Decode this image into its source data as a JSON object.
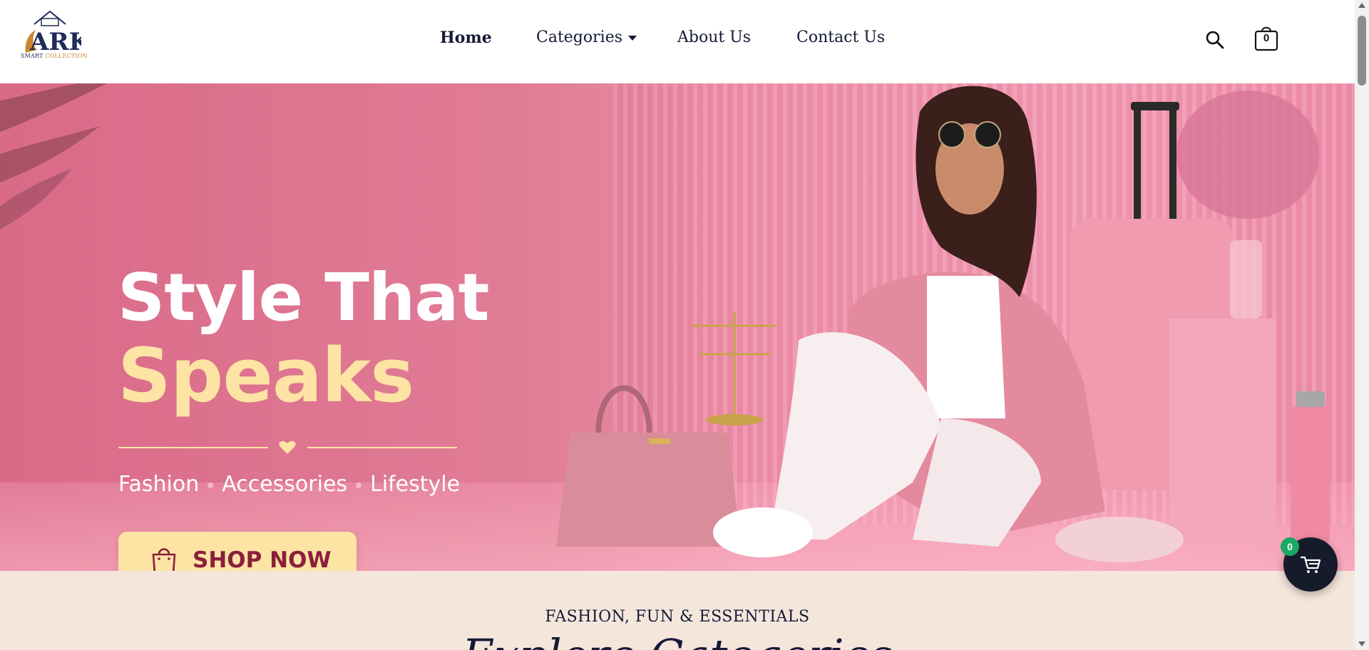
{
  "brand": {
    "logo_letters": "ARK",
    "logo_tagline_1": "SMART",
    "logo_tagline_2": "COLLECTION"
  },
  "nav": {
    "items": [
      {
        "label": "Home",
        "active": true
      },
      {
        "label": "Categories",
        "has_dropdown": true
      },
      {
        "label": "About Us"
      },
      {
        "label": "Contact Us"
      }
    ]
  },
  "header_actions": {
    "search_icon": "search-icon",
    "bag_icon": "shopping-bag-icon",
    "bag_count": "0"
  },
  "hero": {
    "headline_line1": "Style That",
    "headline_line2": "Speaks",
    "tagline_items": [
      "Fashion",
      "Accessories",
      "Lifestyle"
    ],
    "cta_label": "SHOP NOW",
    "colors": {
      "headline_white": "#ffffff",
      "headline_accent": "#fde3a4",
      "cta_bg": "#fde3a4",
      "cta_text": "#8a1f3c",
      "bg_pink": "#e17d97"
    }
  },
  "section": {
    "kicker": "FASHION, FUN & ESSENTIALS",
    "title": "Explore Categories"
  },
  "floating_cart": {
    "icon": "cart-icon",
    "count": "0",
    "badge_color": "#1aa865"
  }
}
